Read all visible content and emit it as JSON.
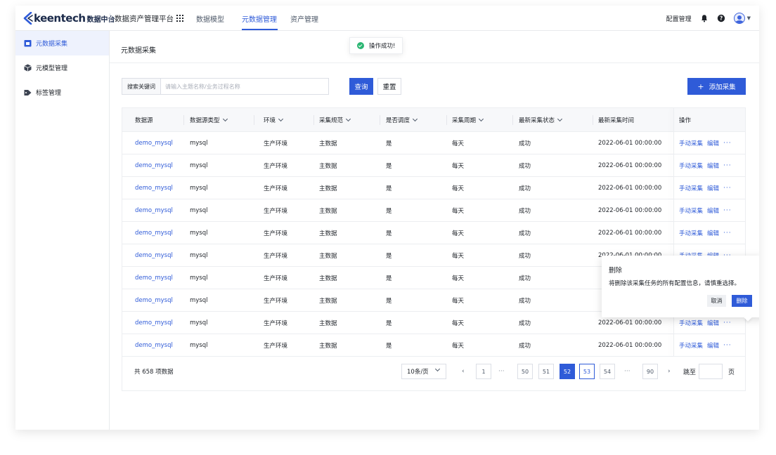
{
  "brand": {
    "logo_text": "keentech",
    "logo_sub": "数据中台"
  },
  "header": {
    "platform": "数据资产管理平台",
    "nav": [
      {
        "label": "数据模型",
        "active": false
      },
      {
        "label": "元数据管理",
        "active": true
      },
      {
        "label": "资产管理",
        "active": false
      }
    ],
    "config_label": "配置管理",
    "icons": [
      "bell-icon",
      "help-icon",
      "avatar",
      "chevron-down-icon"
    ]
  },
  "sidebar": {
    "items": [
      {
        "label": "元数据采集",
        "icon": "collect-icon",
        "active": true
      },
      {
        "label": "元模型管理",
        "icon": "cube-icon",
        "active": false
      },
      {
        "label": "标签管理",
        "icon": "tag-icon",
        "active": false
      }
    ]
  },
  "page": {
    "title": "元数据采集"
  },
  "toast": {
    "text": "操作成功!",
    "color": "#2bb673"
  },
  "search": {
    "label": "搜索关键词",
    "placeholder": "请输入主题名称/业务过程名称",
    "query_button": "查询",
    "reset_button": "重置",
    "add_button": "添加采集"
  },
  "table": {
    "columns": [
      "数据源",
      "数据源类型",
      "环境",
      "采集规范",
      "是否调度",
      "采集周期",
      "最新采集状态",
      "最新采集时间",
      "操作"
    ],
    "rows": [
      [
        "demo_mysql",
        "mysql",
        "生产环境",
        "主数据",
        "是",
        "每天",
        "成功",
        "2022-06-01 00:00:00"
      ],
      [
        "demo_mysql",
        "mysql",
        "生产环境",
        "主数据",
        "是",
        "每天",
        "成功",
        "2022-06-01 00:00:00"
      ],
      [
        "demo_mysql",
        "mysql",
        "生产环境",
        "主数据",
        "是",
        "每天",
        "成功",
        "2022-06-01 00:00:00"
      ],
      [
        "demo_mysql",
        "mysql",
        "生产环境",
        "主数据",
        "是",
        "每天",
        "成功",
        "2022-06-01 00:00:00"
      ],
      [
        "demo_mysql",
        "mysql",
        "生产环境",
        "主数据",
        "是",
        "每天",
        "成功",
        "2022-06-01 00:00:00"
      ],
      [
        "demo_mysql",
        "mysql",
        "生产环境",
        "主数据",
        "是",
        "每天",
        "成功",
        "2022-06-01 00:00:00"
      ],
      [
        "demo_mysql",
        "mysql",
        "生产环境",
        "主数据",
        "是",
        "每天",
        "成功",
        ""
      ],
      [
        "demo_mysql",
        "mysql",
        "生产环境",
        "主数据",
        "是",
        "每天",
        "成功",
        ""
      ],
      [
        "demo_mysql",
        "mysql",
        "生产环境",
        "主数据",
        "是",
        "每天",
        "成功",
        "2022-06-01 00:00:00"
      ],
      [
        "demo_mysql",
        "mysql",
        "生产环境",
        "主数据",
        "是",
        "每天",
        "成功",
        "2022-06-01 00:00:00"
      ]
    ],
    "op_manual": "手动采集",
    "op_edit": "编辑",
    "op_more": "···"
  },
  "pagination": {
    "total": "共 658 项数据",
    "page_size": "10条/页",
    "prev": "‹",
    "next": "›",
    "pages": [
      "1",
      "···",
      "50",
      "51",
      "52",
      "53",
      "54",
      "···",
      "90"
    ],
    "current": "52",
    "jump_label": "跳至",
    "jump_unit": "页"
  },
  "popconfirm": {
    "title": "删除",
    "text": "将删除该采集任务的所有配置信息，请慎重选择。",
    "cancel": "取消",
    "confirm": "删除"
  },
  "colors": {
    "primary": "#2f5bd8",
    "success": "#2bb673"
  }
}
